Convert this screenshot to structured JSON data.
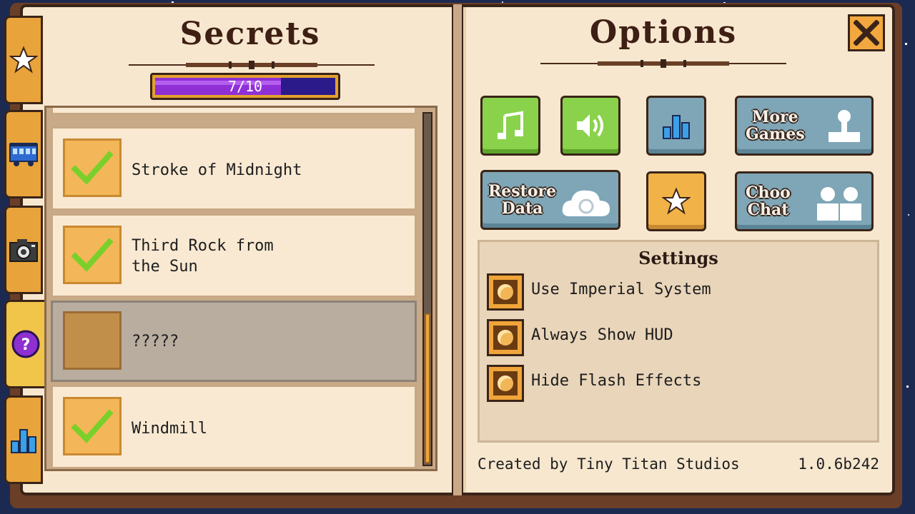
{
  "colors": {
    "background": "#1c2a52",
    "page": "#f7e7cf",
    "tab": "#e8a33a",
    "tab_active": "#f1c44a",
    "progress_fill": "#8f2fd6",
    "progress_track": "#2a1a8a",
    "check": "#7ad02a",
    "button_green": "#8ad24c",
    "button_blue": "#7ea6b7",
    "button_orange": "#f1b248"
  },
  "side_tabs": [
    {
      "icon": "star-icon",
      "active": false
    },
    {
      "icon": "train-icon",
      "active": false
    },
    {
      "icon": "camera-icon",
      "active": false
    },
    {
      "icon": "question-icon",
      "active": true
    },
    {
      "icon": "leaderboard-icon",
      "active": false
    }
  ],
  "secrets": {
    "title": "Secrets",
    "progress_text": "7/10",
    "progress_value": 0.7,
    "items": [
      {
        "label": "Stroke of Midnight",
        "unlocked": true
      },
      {
        "label": "Third Rock from the Sun",
        "unlocked": true
      },
      {
        "label": "?????",
        "unlocked": false
      },
      {
        "label": "Windmill",
        "unlocked": true
      }
    ]
  },
  "options": {
    "title": "Options",
    "close_icon": "close-icon",
    "buttons": {
      "music_icon": "music-note-icon",
      "sound_icon": "speaker-icon",
      "leaderboard_icon": "leaderboard-icon",
      "more_games_line1": "More",
      "more_games_line2": "Games",
      "restore_line1": "Restore",
      "restore_line2": "Data",
      "rate_icon": "star-icon",
      "choo_chat_line1": "Choo",
      "choo_chat_line2": "Chat"
    },
    "settings": {
      "title": "Settings",
      "items": [
        {
          "label": "Use Imperial System",
          "enabled": true
        },
        {
          "label": "Always Show HUD",
          "enabled": true
        },
        {
          "label": "Hide Flash Effects",
          "enabled": true
        }
      ]
    },
    "credit": "Created by Tiny Titan Studios",
    "version": "1.0.6b242"
  }
}
